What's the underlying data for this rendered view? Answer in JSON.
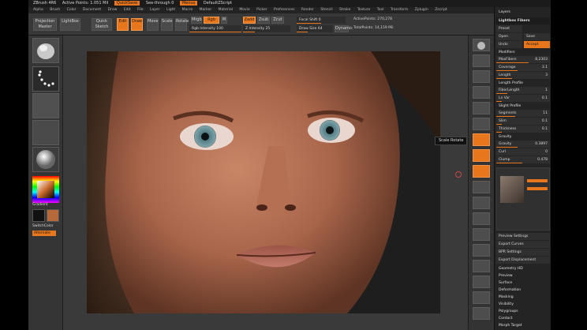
{
  "menubar": {
    "title": "ZBrush 4R6",
    "info": "Active Points: 1.051 Mil",
    "items": [
      "QuickSave",
      "See-through 0",
      "Menus",
      "DefaultZScript"
    ]
  },
  "submenu": {
    "items": [
      "Alpha",
      "Brush",
      "Color",
      "Document",
      "Draw",
      "Edit",
      "File",
      "Layer",
      "Light",
      "Macro",
      "Marker",
      "Material",
      "Movie",
      "Picker",
      "Preferences",
      "Render",
      "Stencil",
      "Stroke",
      "Texture",
      "Tool",
      "Transform",
      "Zplugin",
      "Zscript"
    ]
  },
  "toolbar": {
    "projection_master": "Projection Master",
    "lightbox": "LightBox",
    "quick_sketch": "Quick Sketch",
    "edit": "Edit",
    "draw": "Draw",
    "move": "Move",
    "scale": "Scale",
    "rotate": "Rotate",
    "mrgb": "Mrgb",
    "rgb": "Rgb",
    "m": "M",
    "zadd": "Zadd",
    "zsub": "Zsub",
    "zcut": "Zcut",
    "rgb_intensity": "Rgb Intensity 100",
    "z_intensity": "Z Intensity 25",
    "focal_shift": "Focal Shift 0",
    "draw_size": "Draw Size 64",
    "dynamic": "Dynamic",
    "active_points": "ActivePoints: 270,278",
    "total_points": "TotalPoints: 14,159 Mil"
  },
  "left_shelf": {
    "gradient_label": "Gradient",
    "switch_color": "SwitchColor",
    "alternate": "Alternate"
  },
  "viewport": {
    "tooltip": "Scale Rotate"
  },
  "right_shelf": {
    "buttons": [
      "BPR",
      "SPix 3",
      "Scroll",
      "Zoom",
      "Actual",
      "AAHalf",
      "Persp",
      "Floor",
      "Local",
      "LSym",
      "Xyz",
      "Frame",
      "Move",
      "Scale",
      "Rotate",
      "PolyF",
      "Transp",
      "Solo"
    ]
  },
  "panel": {
    "title": "Layers",
    "subtitle": "Lightbox Fibers",
    "preset": "Preset",
    "open": "Open",
    "save": "Save",
    "undo": "Undo",
    "accept": "Accept",
    "sections": [
      {
        "name": "Modifiers",
        "rows": [
          {
            "label": "MaxFibers",
            "value": "8,2303"
          },
          {
            "label": "Coverage",
            "value": "3.1"
          },
          {
            "label": "Length",
            "value": "3"
          }
        ]
      },
      {
        "name": "Length Profile",
        "rows": [
          {
            "label": "FiberLength",
            "value": "1"
          },
          {
            "label": "Ln Var",
            "value": "0.1"
          }
        ]
      },
      {
        "name": "Slight Profile",
        "rows": [
          {
            "label": "Segments",
            "value": "11"
          },
          {
            "label": "Slim",
            "value": "0.1"
          },
          {
            "label": "Thickness",
            "value": "0.1"
          }
        ]
      },
      {
        "name": "Gravity",
        "rows": [
          {
            "label": "Gravity",
            "value": "0.3897"
          },
          {
            "label": "Curl",
            "value": "0"
          },
          {
            "label": "Clump",
            "value": "0.478"
          }
        ]
      }
    ],
    "bottom_items": [
      "Preview Settings",
      "Export Curves",
      "BPR Settings",
      "Export Displacement"
    ],
    "tool_sections": [
      "Geometry HD",
      "Preview",
      "Surface",
      "Deformation",
      "Masking",
      "Visibility",
      "Polygroups",
      "Contact",
      "Morph Target"
    ]
  }
}
